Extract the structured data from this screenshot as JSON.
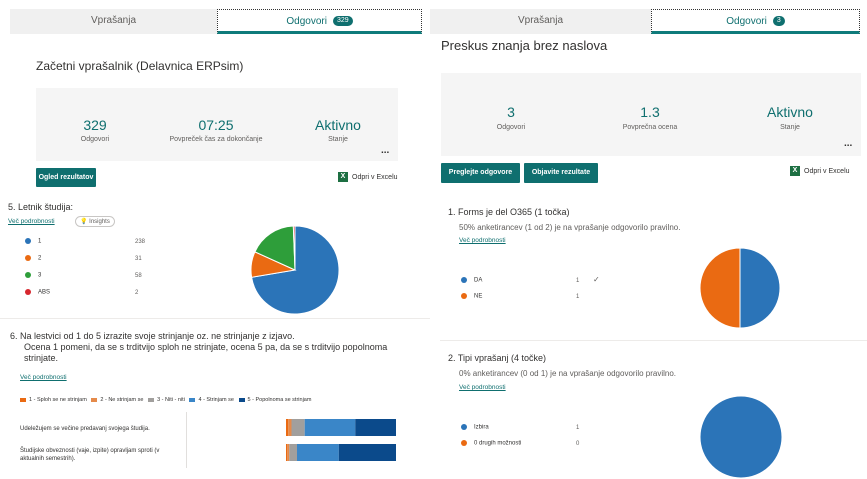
{
  "left": {
    "tabs": [
      {
        "label": "Vprašanja"
      },
      {
        "label": "Odgovori",
        "badge": "329"
      }
    ],
    "form_title": "Začetni vprašalnik (Delavnica ERPsim)",
    "stats": [
      {
        "value": "329",
        "label": "Odgovori"
      },
      {
        "value": "07:25",
        "label": "Povpreček čas za dokončanje"
      },
      {
        "value": "Aktivno",
        "label": "Stanje"
      }
    ],
    "more": "...",
    "view_results_button": "Ogled rezultatov",
    "open_excel": "Odpri v Excelu",
    "q5": {
      "title": "5.  Letnik študija:",
      "details_link": "Več podrobnosti",
      "insights": "Insights",
      "options": [
        {
          "label": "1",
          "count": "238",
          "color": "#2b74b8"
        },
        {
          "label": "2",
          "count": "31",
          "color": "#ea6a12"
        },
        {
          "label": "3",
          "count": "58",
          "color": "#2e9e3a"
        },
        {
          "label": "ABS",
          "count": "2",
          "color": "#d7272e"
        }
      ]
    },
    "q6": {
      "title_lines": [
        "6.  Na lestvici od 1 do 5 izrazite svoje strinjanje oz. ne strinjanje z izjavo.",
        "Ocena 1 pomeni, da se s trditvijo sploh ne strinjate, ocena 5 pa, da se s trditvijo popolnoma",
        "strinjate."
      ],
      "details_link": "Več podrobnosti",
      "legend": [
        {
          "label": "1 - Sploh se ne strinjam",
          "color": "#ea6a12"
        },
        {
          "label": "2 - Ne strinjam se",
          "color": "#e58a4a"
        },
        {
          "label": "3 - Niti - niti",
          "color": "#a19f9d"
        },
        {
          "label": "4 - Strinjam se",
          "color": "#3a86c8"
        },
        {
          "label": "5 - Popolnoma se strinjam",
          "color": "#0b4a8b"
        }
      ],
      "rows": [
        {
          "label": "Udeležujem se večine predavanj svojega študija."
        },
        {
          "label_lines": [
            "Študijske obveznosti (vaje, izpite) opravljam sproti (v",
            "aktualnih semestrih)."
          ]
        }
      ]
    }
  },
  "right": {
    "tabs": [
      {
        "label": "Vprašanja"
      },
      {
        "label": "Odgovori",
        "badge": "3"
      }
    ],
    "form_title": "Preskus znanja brez naslova",
    "stats": [
      {
        "value": "3",
        "label": "Odgovori"
      },
      {
        "value": "1.3",
        "label": "Povprečna ocena"
      },
      {
        "value": "Aktivno",
        "label": "Stanje"
      }
    ],
    "more": "...",
    "review_button": "Preglejte odgovore",
    "publish_button": "Objavite rezultate",
    "open_excel": "Odpri v Excelu",
    "q1": {
      "title": "1.  Forms je del O365 (1 točka)",
      "subtitle": "50% anketirancev (1 od 2) je na vprašanje odgovorilo pravilno.",
      "details_link": "Več podrobnosti",
      "options": [
        {
          "label": "DA",
          "count": "1",
          "color": "#2b74b8",
          "check": "✓"
        },
        {
          "label": "NE",
          "count": "1",
          "color": "#ea6a12"
        }
      ]
    },
    "q2": {
      "title": "2.  Tipi vprašanj (4 točke)",
      "subtitle": "0% anketirancev (0 od 1) je na vprašanje odgovorilo pravilno.",
      "details_link": "Več podrobnosti",
      "options": [
        {
          "label": "Izbira",
          "count": "1",
          "color": "#2b74b8"
        },
        {
          "label": "0 drugih možnosti",
          "count": "0",
          "color": "#ea6a12"
        }
      ]
    }
  },
  "chart_data": [
    {
      "type": "pie",
      "categories": [
        "1",
        "2",
        "3",
        "ABS"
      ],
      "values": [
        238,
        31,
        58,
        2
      ],
      "colors": [
        "#2b74b8",
        "#ea6a12",
        "#2e9e3a",
        "#d7272e"
      ]
    },
    {
      "type": "bar",
      "stacked": true,
      "orientation": "horizontal",
      "categories": [
        "Udeležujem se večine predavanj svojega študija.",
        "Študijske obveznosti (vaje, izpite) opravljam sproti (v aktualnih semestrih)."
      ],
      "series": [
        {
          "name": "1 - Sploh se ne strinjam",
          "values": [
            2,
            1
          ]
        },
        {
          "name": "2 - Ne strinjam se",
          "values": [
            3,
            2
          ]
        },
        {
          "name": "3 - Niti - niti",
          "values": [
            12,
            7
          ]
        },
        {
          "name": "4 - Strinjam se",
          "values": [
            46,
            38
          ]
        },
        {
          "name": "5 - Popolnoma se strinjam",
          "values": [
            37,
            52
          ]
        }
      ]
    },
    {
      "type": "pie",
      "categories": [
        "DA",
        "NE"
      ],
      "values": [
        1,
        1
      ],
      "colors": [
        "#2b74b8",
        "#ea6a12"
      ]
    },
    {
      "type": "pie",
      "categories": [
        "Izbira",
        "0 drugih možnosti"
      ],
      "values": [
        1,
        0
      ],
      "colors": [
        "#2b74b8",
        "#ea6a12"
      ]
    }
  ]
}
